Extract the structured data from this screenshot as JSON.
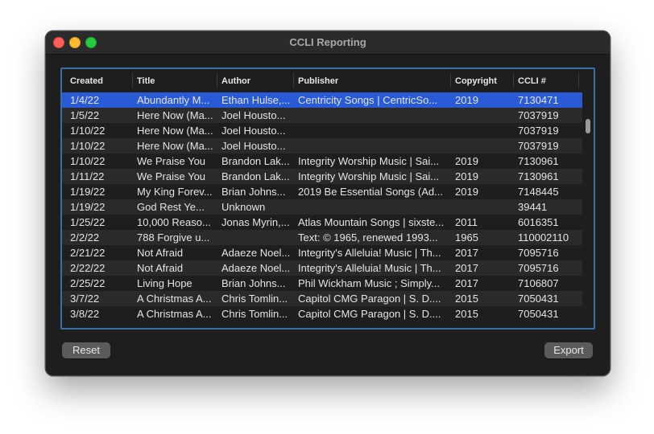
{
  "window": {
    "title": "CCLI Reporting"
  },
  "table": {
    "columns": [
      "Created",
      "Title",
      "Author",
      "Publisher",
      "Copyright",
      "CCLI #"
    ],
    "rows": [
      {
        "created": "1/4/22",
        "title": "Abundantly M...",
        "author": "Ethan Hulse,...",
        "publisher": "Centricity Songs | CentricSo...",
        "copyright": "2019",
        "ccli": "7130471"
      },
      {
        "created": "1/5/22",
        "title": "Here Now (Ma...",
        "author": "Joel Housto...",
        "publisher": "",
        "copyright": "",
        "ccli": "7037919"
      },
      {
        "created": "1/10/22",
        "title": "Here Now (Ma...",
        "author": "Joel Housto...",
        "publisher": "",
        "copyright": "",
        "ccli": "7037919"
      },
      {
        "created": "1/10/22",
        "title": "Here Now (Ma...",
        "author": "Joel Housto...",
        "publisher": "",
        "copyright": "",
        "ccli": "7037919"
      },
      {
        "created": "1/10/22",
        "title": "We Praise You",
        "author": "Brandon Lak...",
        "publisher": "Integrity Worship Music | Sai...",
        "copyright": "2019",
        "ccli": "7130961"
      },
      {
        "created": "1/11/22",
        "title": "We Praise You",
        "author": "Brandon Lak...",
        "publisher": "Integrity Worship Music | Sai...",
        "copyright": "2019",
        "ccli": "7130961"
      },
      {
        "created": "1/19/22",
        "title": "My King Forev...",
        "author": "Brian Johns...",
        "publisher": "2019 Be Essential Songs (Ad...",
        "copyright": "2019",
        "ccli": "7148445"
      },
      {
        "created": "1/19/22",
        "title": "God Rest Ye...",
        "author": "Unknown",
        "publisher": "",
        "copyright": "",
        "ccli": "39441"
      },
      {
        "created": "1/25/22",
        "title": "10,000 Reaso...",
        "author": "Jonas Myrin,...",
        "publisher": "Atlas Mountain Songs | sixste...",
        "copyright": "2011",
        "ccli": "6016351"
      },
      {
        "created": "2/2/22",
        "title": "788 Forgive u...",
        "author": "",
        "publisher": "Text: © 1965, renewed 1993...",
        "copyright": "1965",
        "ccli": "110002110"
      },
      {
        "created": "2/21/22",
        "title": "Not Afraid",
        "author": "Adaeze Noel...",
        "publisher": "Integrity's Alleluia! Music | Th...",
        "copyright": "2017",
        "ccli": "7095716"
      },
      {
        "created": "2/22/22",
        "title": "Not Afraid",
        "author": "Adaeze Noel...",
        "publisher": "Integrity's Alleluia! Music | Th...",
        "copyright": "2017",
        "ccli": "7095716"
      },
      {
        "created": "2/25/22",
        "title": "Living Hope",
        "author": "Brian Johns...",
        "publisher": "Phil Wickham Music ;  Simply...",
        "copyright": "2017",
        "ccli": "7106807"
      },
      {
        "created": "3/7/22",
        "title": "A Christmas A...",
        "author": "Chris Tomlin...",
        "publisher": "Capitol CMG Paragon | S. D....",
        "copyright": "2015",
        "ccli": "7050431"
      },
      {
        "created": "3/8/22",
        "title": "A Christmas A...",
        "author": "Chris Tomlin...",
        "publisher": "Capitol CMG Paragon | S. D....",
        "copyright": "2015",
        "ccli": "7050431"
      }
    ]
  },
  "buttons": {
    "reset": "Reset",
    "export": "Export"
  },
  "colors": {
    "selection": "#2a5bd7",
    "focus_ring": "#3b6ea8"
  }
}
